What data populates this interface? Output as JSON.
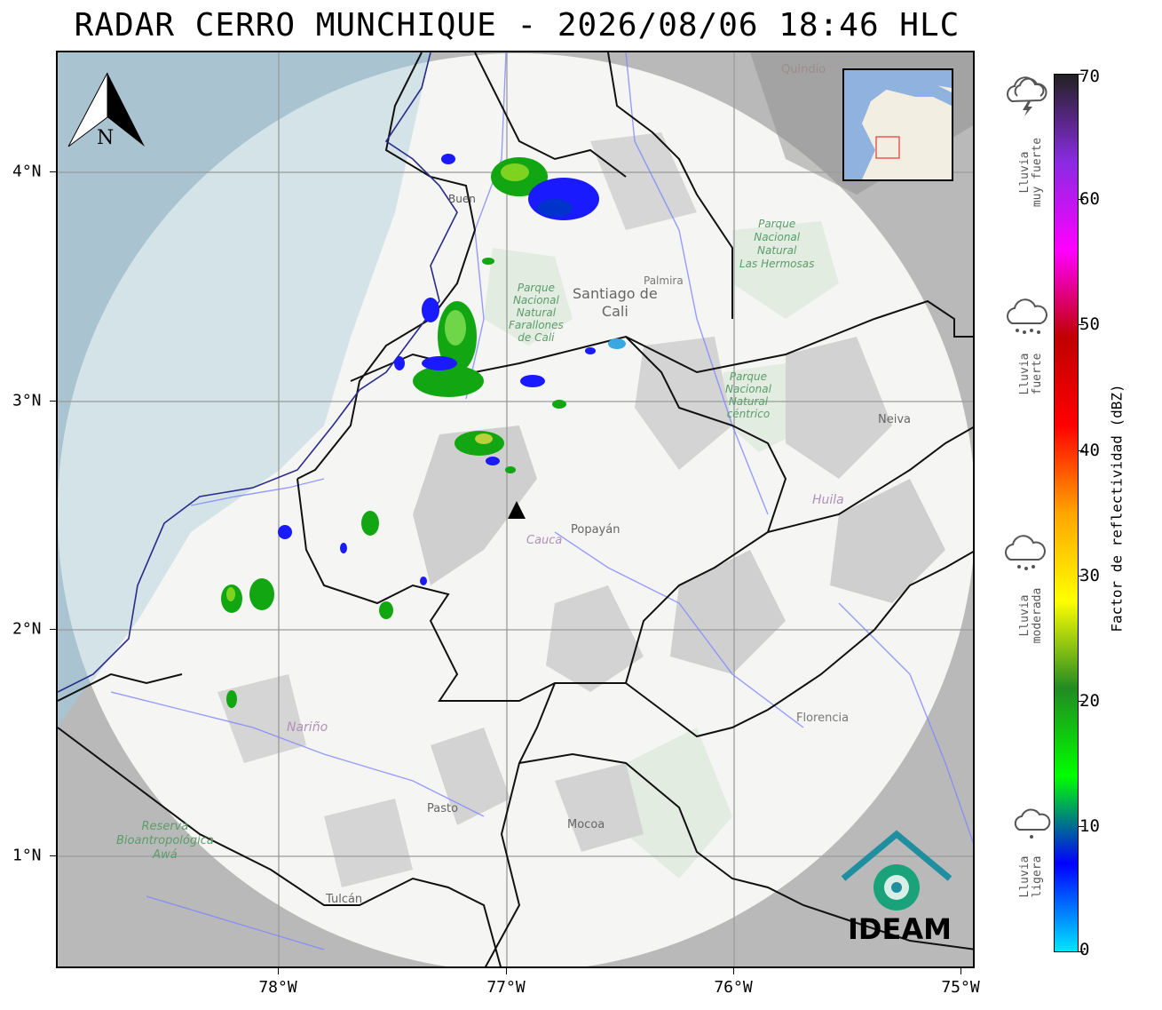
{
  "title": "RADAR CERRO MUNCHIQUE - 2026/08/06 18:46 HLC",
  "axes": {
    "x_ticks": [
      "78°W",
      "77°W",
      "76°W",
      "75°W"
    ],
    "y_ticks": [
      "4°N",
      "3°N",
      "2°N",
      "1°N"
    ]
  },
  "north_arrow": {
    "label": "N"
  },
  "colorbar": {
    "label": "Factor de reflectividad (dBZ)",
    "ticks": [
      "70",
      "60",
      "50",
      "40",
      "30",
      "20",
      "10",
      "0"
    ],
    "colors": [
      "#00e5ff",
      "#0000ff",
      "#00ff00",
      "#228b22",
      "#ffff00",
      "#ffa500",
      "#ff0000",
      "#c00000",
      "#ff00ff",
      "#8a2be2",
      "#222222"
    ]
  },
  "rain_categories": [
    {
      "label": "Lluvia\nmuy fuerte",
      "icon": "storm-cloud-icon"
    },
    {
      "label": "Lluvia\nfuerte",
      "icon": "heavy-rain-cloud-icon"
    },
    {
      "label": "Lluvia\nmoderada",
      "icon": "moderate-rain-cloud-icon"
    },
    {
      "label": "Lluvia\nligera",
      "icon": "light-rain-cloud-icon"
    }
  ],
  "places": {
    "quindio": "Quindío",
    "buenaventura": "Buen",
    "santiago_de_cali": "Santiago de\nCali",
    "palmira": "Palmira",
    "farallones": "Parque\nNacional\nNatural\nFarallones\nde Cali",
    "las_hermosas": "Parque\nNacional\nNatural\nLas Hermosas",
    "nacional_natural": "Parque\nNacional\nNatural\ncéntrico",
    "neiva": "Neiva",
    "huila": "Huila",
    "popayan": "Popayán",
    "cauca": "Cauca",
    "narino": "Nariño",
    "florencia": "Florencia",
    "pasto": "Pasto",
    "mocoa": "Mocoa",
    "tulcan": "Tulcán",
    "reserva": "Reserva\nBioantropológica\nAwá"
  },
  "logo": {
    "text": "IDEAM",
    "color": "#1aa37a"
  },
  "radar_marker": {
    "name": "Cerro Munchique"
  }
}
